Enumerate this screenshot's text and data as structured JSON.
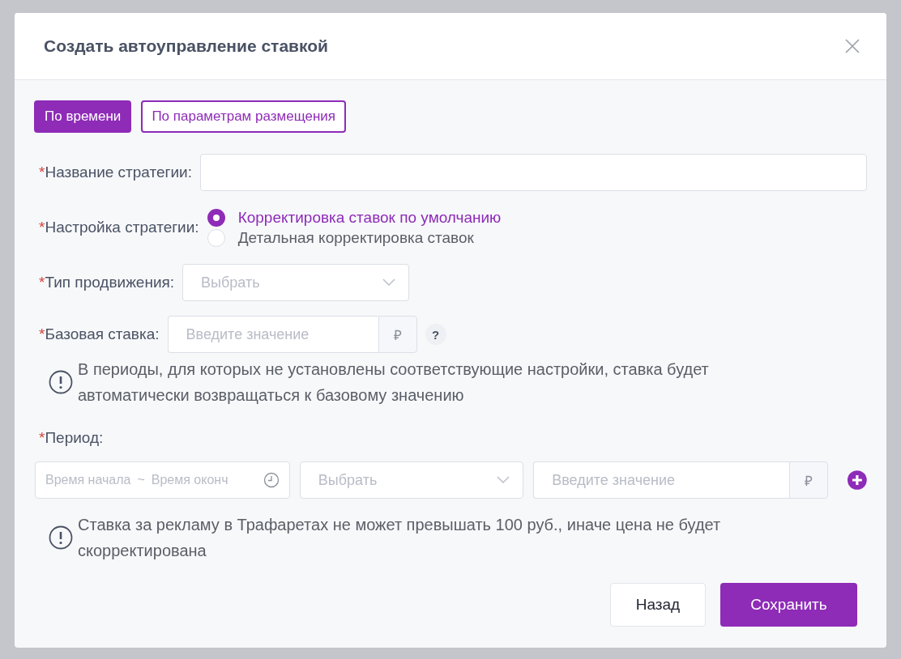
{
  "dialog": {
    "title": "Создать автоуправление ставкой"
  },
  "tabs": [
    {
      "label": "По времени",
      "selected": true
    },
    {
      "label": "По параметрам размещения",
      "selected": false
    }
  ],
  "strategy_name": {
    "mark": "*",
    "label": "Название стратегии:"
  },
  "strategy_setting": {
    "mark": "*",
    "label": "Настройка стратегии:",
    "options": [
      {
        "label": "Корректировка ставок по умолчанию",
        "selected": true
      },
      {
        "label": "Детальная корректировка ставок",
        "selected": false
      }
    ]
  },
  "promotion_type": {
    "mark": "*",
    "label": "Тип продвижения:",
    "placeholder": "Выбрать"
  },
  "base_bid": {
    "mark": "*",
    "label": "Базовая ставка:",
    "placeholder": "Введите значение",
    "currency": "₽",
    "help": "?"
  },
  "base_note": "В периоды, для которых не установлены соответствующие настройки, ставка будет автоматически возвращаться к базовому значению",
  "period": {
    "mark": "*",
    "label": "Период:",
    "start_placeholder": "Время начала",
    "separator": "~",
    "end_placeholder": "Время оконч",
    "select_placeholder": "Выбрать",
    "value_placeholder": "Введите значение",
    "currency": "₽"
  },
  "period_note": "Ставка за рекламу в Трафаретах не может превышать 100 руб., иначе цена не будет скорректирована",
  "buttons": [
    {
      "label": "Назад",
      "kind": "secondary"
    },
    {
      "label": "Сохранить",
      "kind": "primary"
    }
  ]
}
